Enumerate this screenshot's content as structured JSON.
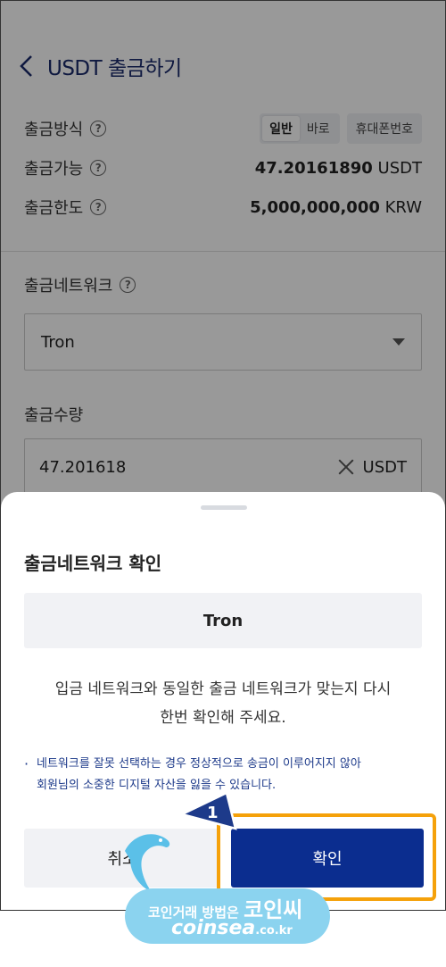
{
  "header": {
    "title": "USDT 출금하기"
  },
  "summary": {
    "method_label": "출금방식",
    "method_options": [
      "일반",
      "바로"
    ],
    "method_selected": "일반",
    "phone_option": "휴대폰번호",
    "available_label": "출금가능",
    "available_amount": "47.20161890",
    "available_unit": "USDT",
    "limit_label": "출금한도",
    "limit_amount": "5,000,000,000",
    "limit_unit": "KRW"
  },
  "network": {
    "label": "출금네트워크",
    "selected": "Tron"
  },
  "amount": {
    "label": "출금수량",
    "value": "47.201618",
    "unit": "USDT"
  },
  "dialog": {
    "title": "출금네트워크 확인",
    "network": "Tron",
    "message_line1": "입금 네트워크와 동일한 출금 네트워크가 맞는지 다시",
    "message_line2": "한번 확인해 주세요.",
    "warning_line1": "네트워크를 잘못 선택하는 경우 정상적으로 송금이 이루어지지 않아",
    "warning_line2": "회원님의 소중한 디지털 자산을 잃을 수 있습니다.",
    "cancel_label": "취소",
    "confirm_label": "확인"
  },
  "annotation": {
    "step": "1"
  },
  "watermark": {
    "line1": "코인거래 방법은",
    "brand": "코인씨",
    "domain": "coinsea",
    "tld": ".co.kr"
  },
  "colors": {
    "primary": "#0b2d8f",
    "highlight": "#f5a10a",
    "watermark": "#8bd3ef"
  }
}
